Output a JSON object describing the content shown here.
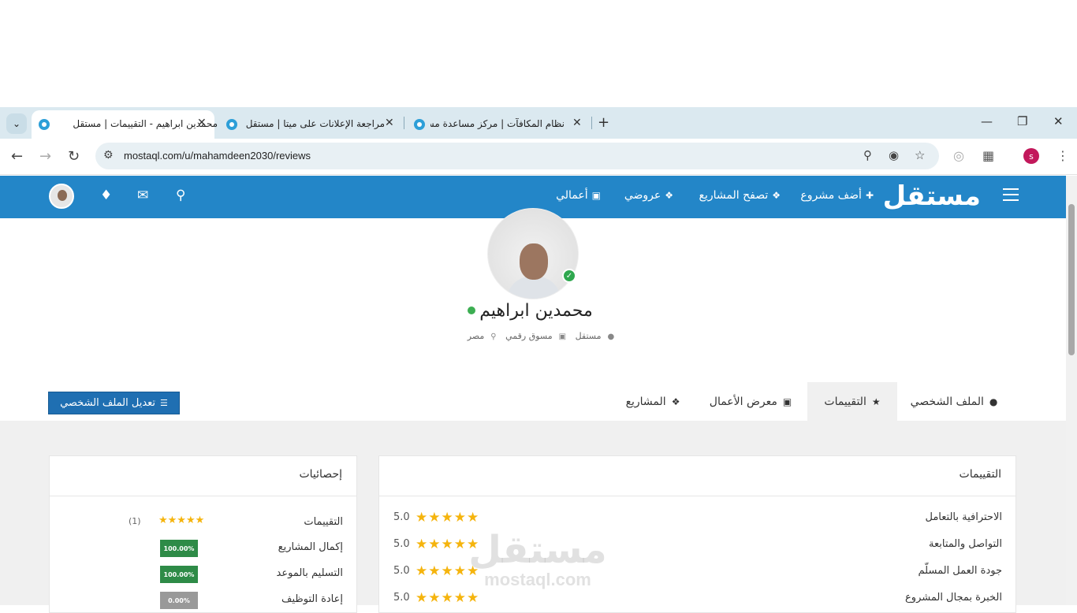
{
  "browser": {
    "tabs": [
      {
        "title": "محمدين ابراهيم - التقييمات | مستقل",
        "active": true
      },
      {
        "title": "مراجعة الإعلانات على ميتا | مستقل",
        "active": false
      },
      {
        "title": "نظام المكافآت | مركز مساعدة مستقل",
        "active": false
      }
    ],
    "url": "mostaql.com/u/mahamdeen2030/reviews",
    "profile_initial": "s",
    "icons": {
      "tab_menu": "chevron-down-icon",
      "new_tab": "plus-icon",
      "minimize": "minimize-icon",
      "restore": "restore-icon",
      "close": "close-icon",
      "back": "back-arrow-icon",
      "forward": "forward-arrow-icon",
      "reload": "reload-icon",
      "site_info": "tune-icon",
      "zoom": "zoom-icon",
      "eye_off": "eye-off-icon",
      "bookmark": "star-outline-icon",
      "translate": "globe-icon",
      "extensions": "puzzle-icon",
      "menu": "kebab-menu-icon"
    }
  },
  "site": {
    "logo": "مستقل",
    "nav": [
      {
        "label": "أضف مشروع",
        "icon": "plus-icon"
      },
      {
        "label": "تصفح المشاريع",
        "icon": "cubes-icon"
      },
      {
        "label": "عروضي",
        "icon": "tag-icon"
      },
      {
        "label": "أعمالي",
        "icon": "briefcase-icon"
      }
    ],
    "brand_color": "#2386c8"
  },
  "profile": {
    "name": "محمدين ابراهيم",
    "meta": {
      "role": "مستقل",
      "title": "مسوق رقمي",
      "country": "مصر"
    },
    "online": true,
    "verified": true
  },
  "tabs": [
    {
      "label": "الملف الشخصي",
      "icon": "user-icon"
    },
    {
      "label": "التقييمات",
      "icon": "star-icon",
      "active": true
    },
    {
      "label": "معرض الأعمال",
      "icon": "briefcase-icon"
    },
    {
      "label": "المشاريع",
      "icon": "cubes-icon"
    }
  ],
  "edit_profile_label": "تعديل الملف الشخصي",
  "reviews": {
    "title": "التقييمات",
    "rows": [
      {
        "label": "الاحترافية بالتعامل",
        "stars": 5,
        "score": "5.0"
      },
      {
        "label": "التواصل والمتابعة",
        "stars": 5,
        "score": "5.0"
      },
      {
        "label": "جودة العمل المسلّم",
        "stars": 5,
        "score": "5.0"
      },
      {
        "label": "الخبرة بمجال المشروع",
        "stars": 5,
        "score": "5.0"
      }
    ]
  },
  "stats": {
    "title": "إحصائيات",
    "rating": {
      "label": "التقييمات",
      "stars": 5,
      "count": "(1)"
    },
    "rows": [
      {
        "label": "إكمال المشاريع",
        "value": "100.00%",
        "color": "green"
      },
      {
        "label": "التسليم بالموعد",
        "value": "100.00%",
        "color": "green"
      },
      {
        "label": "إعادة التوظيف",
        "value": "0.00%",
        "color": "gray"
      }
    ]
  },
  "watermark": {
    "arabic": "مستقل",
    "latin": "mostaql.com"
  }
}
